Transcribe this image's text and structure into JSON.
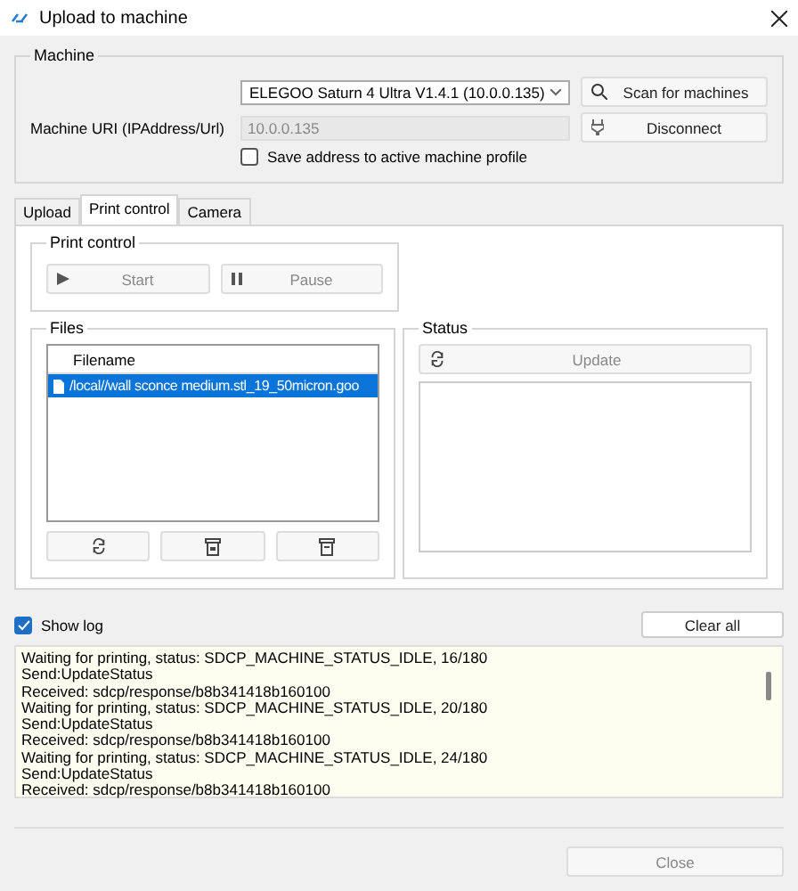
{
  "window": {
    "title": "Upload to machine"
  },
  "machine": {
    "group_title": "Machine",
    "profile": "ELEGOO Saturn 4 Ultra V1.4.1 (10.0.0.135)",
    "uri_label": "Machine URI (IPAddress/Url)",
    "uri_value": "10.0.0.135",
    "uri_disabled": true,
    "scan_button": "Scan for machines",
    "disconnect_button": "Disconnect",
    "save_address": {
      "label": "Save address to active machine profile",
      "checked": false
    }
  },
  "tabs": [
    {
      "label": "Upload",
      "selected": false
    },
    {
      "label": "Print control",
      "selected": true
    },
    {
      "label": "Camera",
      "selected": false
    }
  ],
  "print_control": {
    "title": "Print control",
    "buttons": [
      {
        "kind": "start",
        "label": "Start",
        "disabled": true
      },
      {
        "kind": "pause",
        "label": "Pause",
        "disabled": true
      }
    ]
  },
  "files": {
    "title": "Files",
    "column": "Filename",
    "rows": [
      {
        "name": "/local//wall sconce medium.stl_19_50micron.goo",
        "selected": true
      }
    ],
    "tools": [
      {
        "kind": "refresh"
      },
      {
        "kind": "archive"
      },
      {
        "kind": "delete"
      }
    ]
  },
  "status": {
    "title": "Status",
    "update_button": "Update",
    "update_disabled": true
  },
  "show_log": {
    "label": "Show log",
    "checked": true
  },
  "clear_button": "Clear all",
  "log": [
    "Waiting for printing, status: SDCP_MACHINE_STATUS_IDLE, 16/180",
    "Send:UpdateStatus",
    "Received: sdcp/response/b8b341418b160100",
    "Waiting for printing, status: SDCP_MACHINE_STATUS_IDLE, 20/180",
    "Send:UpdateStatus",
    "Received: sdcp/response/b8b341418b160100",
    "Waiting for printing, status: SDCP_MACHINE_STATUS_IDLE, 24/180",
    "Send:UpdateStatus",
    "Received: sdcp/response/b8b341418b160100"
  ],
  "close_button": {
    "label": "Close",
    "disabled": true
  }
}
